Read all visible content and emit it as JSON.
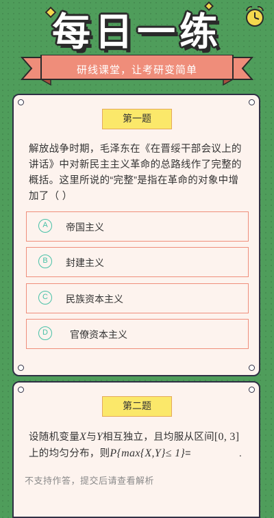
{
  "header": {
    "title": "每日一练",
    "slogan": "研线课堂，让考研变简单"
  },
  "colors": {
    "background": "#4f9d5b",
    "card": "#fdf3ee",
    "badge": "#fbe86a",
    "option_border": "#ef8d7a",
    "option_letter": "#46c0a6",
    "ribbon": "#ef8d7a"
  },
  "questions": [
    {
      "badge": "第一题",
      "text": "解放战争时期，毛泽东在《在晋绥干部会议上的讲话》中对新民主主义革命的总路线作了完整的概括。这里所说的“完整”是指在革命的对象中增加了（ ）",
      "options": [
        {
          "letter": "A",
          "label": "帝国主义"
        },
        {
          "letter": "B",
          "label": "封建主义"
        },
        {
          "letter": "C",
          "label": "民族资本主义"
        },
        {
          "letter": "D",
          "label": "官僚资本主义"
        }
      ]
    },
    {
      "badge": "第二题",
      "text_parts": {
        "p1": "设随机变量",
        "x": "X",
        "p2": "与",
        "y": "Y",
        "p3": "相互独立，且均服从区间",
        "interval": "[0, 3]",
        "p4": "上的均匀分布，则",
        "formula": "P{max{X,Y}≤ 1}",
        "p5": "=",
        "blank_end": "."
      },
      "hint": "不支持作答，提交后请查看解析"
    }
  ]
}
